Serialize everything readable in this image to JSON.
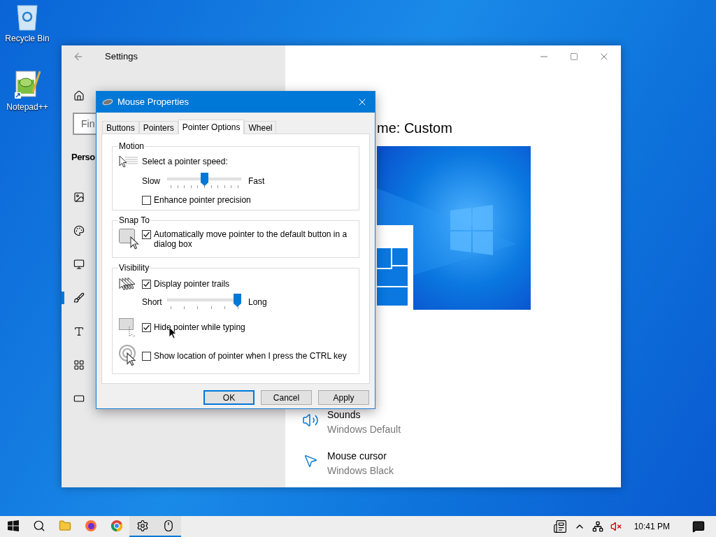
{
  "desktop_icons": [
    {
      "kind": "recycle",
      "label": "Recycle Bin"
    },
    {
      "kind": "notepad",
      "label": "Notepad++"
    }
  ],
  "settings_window": {
    "title": "Settings",
    "search": {
      "placeholder": "Fin"
    },
    "section": "Perso",
    "nav_items": [
      {
        "kind": "picture",
        "selected": false
      },
      {
        "kind": "palette",
        "selected": false
      },
      {
        "kind": "lock",
        "selected": false
      },
      {
        "kind": "theme",
        "selected": true
      },
      {
        "kind": "font",
        "selected": false
      },
      {
        "kind": "start",
        "selected": false
      },
      {
        "kind": "taskbar",
        "selected": false
      }
    ],
    "heading": "me: Custom",
    "items": [
      {
        "kind": "sound",
        "title": "Sounds",
        "value": "Windows Default"
      },
      {
        "kind": "cursor",
        "title": "Mouse cursor",
        "value": "Windows Black"
      }
    ]
  },
  "dialog": {
    "title": "Mouse Properties",
    "tabs": [
      {
        "label": "Buttons",
        "selected": false
      },
      {
        "label": "Pointers",
        "selected": false
      },
      {
        "label": "Pointer Options",
        "selected": true
      },
      {
        "label": "Wheel",
        "selected": false
      }
    ],
    "groups": [
      {
        "title": "Motion",
        "rows": [
          {
            "kind": "text",
            "text": "Select a pointer speed:"
          },
          {
            "kind": "slider",
            "min_label": "Slow",
            "max_label": "Fast",
            "level": 0.5
          },
          {
            "kind": "checkbox",
            "label": "Enhance pointer precision",
            "checked": false
          }
        ]
      },
      {
        "title": "Snap To",
        "rows": [
          {
            "kind": "checkbox",
            "label": "Automatically move pointer to the default button in a dialog box",
            "checked": true
          }
        ]
      },
      {
        "title": "Visibility",
        "rows": [
          {
            "kind": "checkbox",
            "label": "Display pointer trails",
            "checked": true
          },
          {
            "kind": "slider",
            "min_label": "Short",
            "max_label": "Long",
            "level": 1
          },
          {
            "kind": "checkbox",
            "label": "Hide pointer while typing",
            "checked": true
          },
          {
            "kind": "checkbox",
            "label": "Show location of pointer when I press the CTRL key",
            "checked": false
          }
        ]
      }
    ],
    "buttons": [
      {
        "label": "OK",
        "default": true
      },
      {
        "label": "Cancel",
        "default": false
      },
      {
        "label": "Apply",
        "default": false
      }
    ]
  },
  "taskbar": {
    "apps": [
      {
        "kind": "start",
        "active": false
      },
      {
        "kind": "search",
        "active": false
      },
      {
        "kind": "folder",
        "active": false
      },
      {
        "kind": "firefox",
        "active": false
      },
      {
        "kind": "chrome",
        "active": false
      },
      {
        "kind": "settings",
        "active": true
      },
      {
        "kind": "mouse",
        "active": true
      }
    ],
    "tray": [
      {
        "kind": "news"
      },
      {
        "kind": "chevron"
      },
      {
        "kind": "network"
      },
      {
        "kind": "volume-muted"
      }
    ],
    "time": "10:41 PM"
  }
}
